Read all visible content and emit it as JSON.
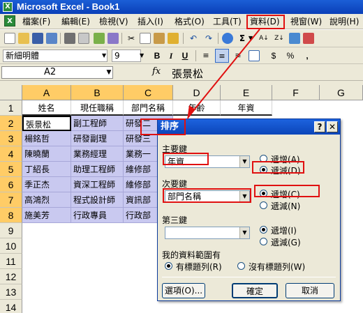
{
  "window": {
    "title": "Microsoft Excel - Book1",
    "app_icon": "X"
  },
  "menubar": {
    "items": [
      {
        "name": "file",
        "label": "檔案(F)"
      },
      {
        "name": "edit",
        "label": "編輯(E)"
      },
      {
        "name": "view",
        "label": "檢視(V)"
      },
      {
        "name": "insert",
        "label": "插入(I)"
      },
      {
        "name": "format",
        "label": "格式(O)"
      },
      {
        "name": "tools",
        "label": "工具(T)"
      },
      {
        "name": "data",
        "label": "資料(D)"
      },
      {
        "name": "window",
        "label": "視窗(W)"
      },
      {
        "name": "help",
        "label": "說明(H)"
      }
    ],
    "highlighted": "資料(D)"
  },
  "format_toolbar": {
    "font_name": "新細明體",
    "font_size": "9",
    "bold": "B",
    "italic": "I",
    "underline": "U",
    "currency": "$",
    "percent": "%",
    "comma": ","
  },
  "formula_bar": {
    "cell_ref": "A2",
    "fx": "fx",
    "value": "張景松"
  },
  "sheet": {
    "columns": [
      "A",
      "B",
      "C",
      "D",
      "E",
      "F",
      "G"
    ],
    "rows": [
      "1",
      "2",
      "3",
      "4",
      "5",
      "6",
      "7",
      "8",
      "9",
      "10",
      "11",
      "12",
      "13",
      "14"
    ],
    "headers": [
      "姓名",
      "現任職稱",
      "部門名稱",
      "年齡",
      "年資"
    ],
    "data": [
      [
        "張景松",
        "副工程師",
        "研發二"
      ],
      [
        "楊銘哲",
        "研發副理",
        "研發三"
      ],
      [
        "陳曉蘭",
        "業務經理",
        "業務一"
      ],
      [
        "丁紹長",
        "助理工程師",
        "維修部"
      ],
      [
        "季正杰",
        "資深工程師",
        "維修部"
      ],
      [
        "高鴻烈",
        "程式設計師",
        "資訊部"
      ],
      [
        "施美芳",
        "行政專員",
        "行政部"
      ]
    ]
  },
  "dialog": {
    "title": "排序",
    "help_btn": "?",
    "close_btn": "✕",
    "primary": {
      "label": "主要鍵",
      "value": "年資",
      "asc": "遞增(A)",
      "desc": "遞減(D)",
      "selected": "desc"
    },
    "secondary": {
      "label": "次要鍵",
      "value": "部門名稱",
      "asc": "遞增(C)",
      "desc": "遞減(N)",
      "selected": "asc"
    },
    "tertiary": {
      "label": "第三鍵",
      "value": "",
      "asc": "遞增(I)",
      "desc": "遞減(G)",
      "selected": "asc"
    },
    "range": {
      "label": "我的資料範圍有",
      "with_header": "有標題列(R)",
      "without_header": "沒有標題列(W)",
      "selected": "with_header"
    },
    "options_btn": "選項(O)...",
    "ok_btn": "確定",
    "cancel_btn": "取消"
  },
  "colors": {
    "highlight": "#e01010",
    "selection": "#c9c9f0",
    "titlebar": "#0b45b9"
  }
}
